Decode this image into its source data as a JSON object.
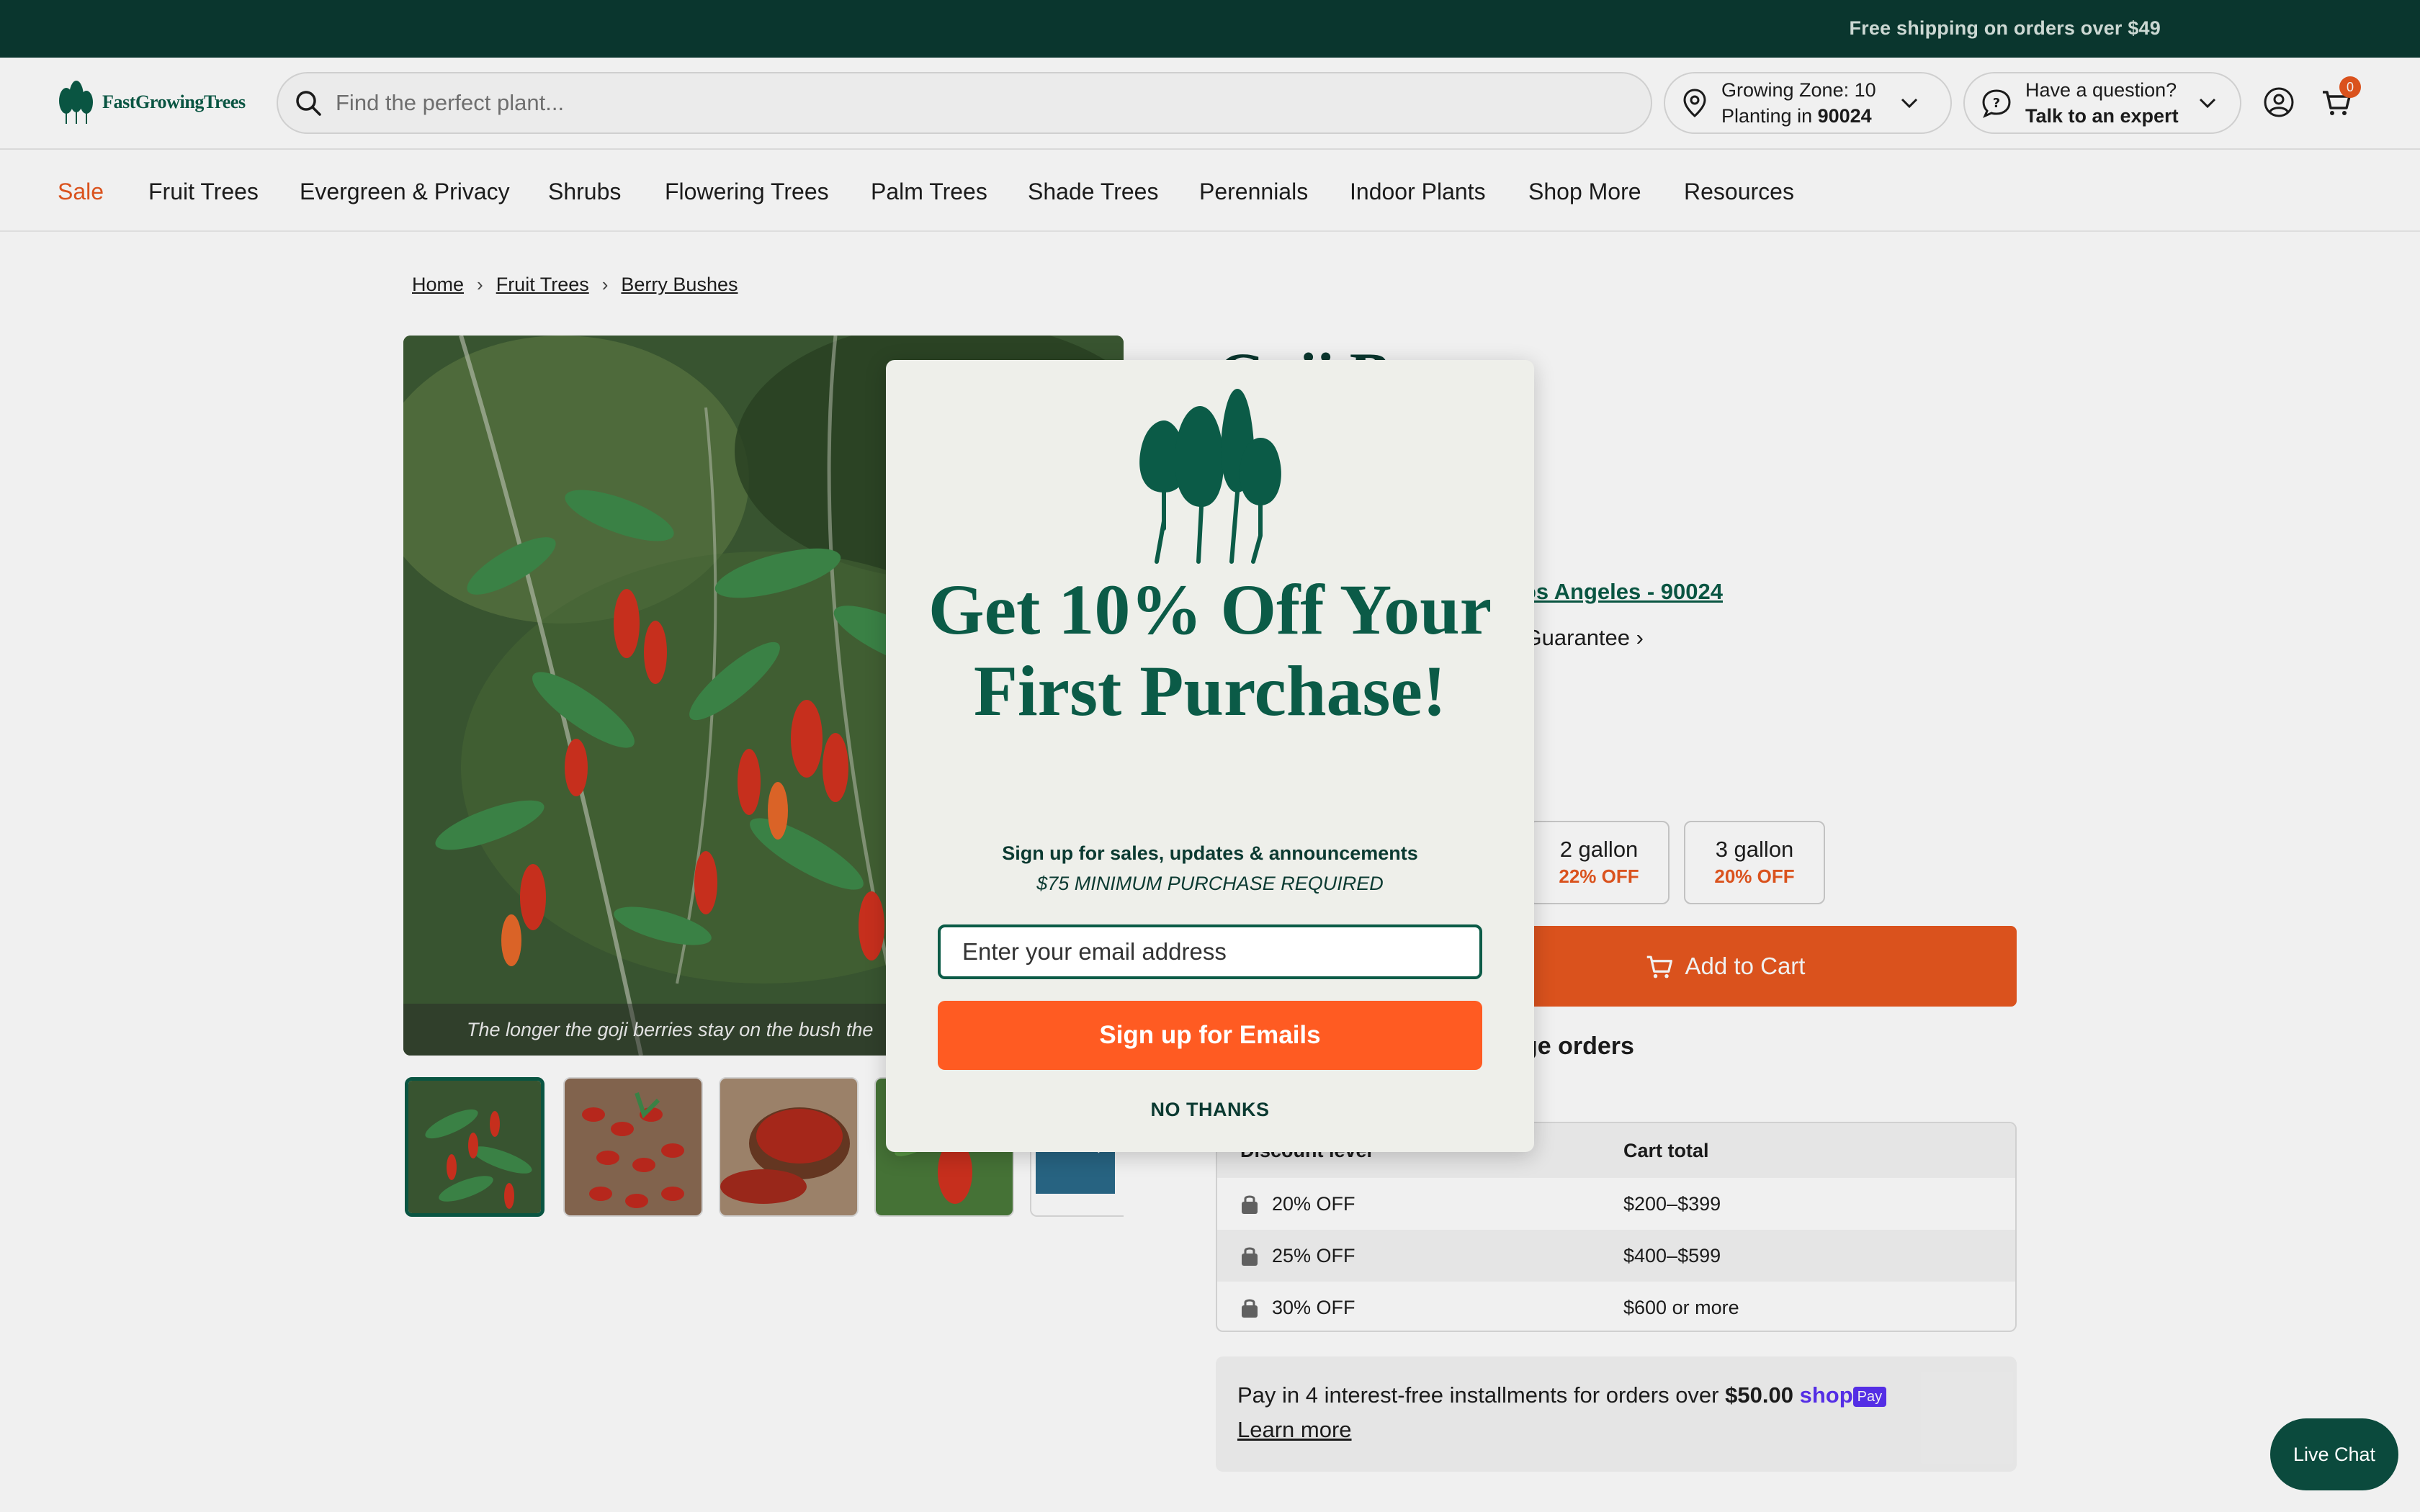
{
  "promo": {
    "text": "Free shipping on orders over $49"
  },
  "header": {
    "logo_text": "FastGrowingTrees",
    "search_placeholder": "Find the perfect plant...",
    "zone_line1": "Growing Zone: 10",
    "zone_line2_prefix": "Planting in ",
    "zone_line2_zip": "90024",
    "question_line1": "Have a question?",
    "question_line2": "Talk to an expert",
    "cart_count": "0"
  },
  "nav": {
    "items": [
      "Sale",
      "Fruit Trees",
      "Evergreen & Privacy",
      "Shrubs",
      "Flowering Trees",
      "Palm Trees",
      "Shade Trees",
      "Perennials",
      "Indoor Plants",
      "Shop More",
      "Resources"
    ]
  },
  "breadcrumb": [
    "Home",
    "Fruit Trees",
    "Berry Bushes"
  ],
  "gallery": {
    "caption": "The longer the goji berries stay on the bush the"
  },
  "product": {
    "title_partial": "Goji B",
    "location_link": "os Angeles - 90024",
    "guarantee": "' Guarantee",
    "sizes": [
      {
        "label": "2 gallon",
        "discount": "22% OFF"
      },
      {
        "label": "3 gallon",
        "discount": "20% OFF"
      }
    ],
    "add_to_cart": "Add to Cart",
    "bulk_heading": "ge orders"
  },
  "discount_table": {
    "headers": [
      "Discount level",
      "Cart total"
    ],
    "rows": [
      {
        "level": "20% OFF",
        "total": "$200–$399"
      },
      {
        "level": "25% OFF",
        "total": "$400–$599"
      },
      {
        "level": "30% OFF",
        "total": "$600 or more"
      }
    ]
  },
  "installments": {
    "text": "Pay in 4 interest-free installments for orders over ",
    "amount": "$50.00",
    "brand": "shop",
    "brand_tag": "Pay",
    "learn_more": "Learn more"
  },
  "modal": {
    "title": "Get 10% Off Your First Purchase!",
    "subtitle": "Sign up for sales, updates & announcements",
    "minimum": "$75 MINIMUM PURCHASE REQUIRED",
    "email_placeholder": "Enter your email address",
    "signup_button": "Sign up for Emails",
    "no_thanks": "NO THANKS"
  },
  "live_chat": "Live Chat",
  "colors": {
    "brand_green": "#0b5b47",
    "dark_green": "#0b3a31",
    "accent_orange": "#e8581f",
    "signup_orange": "#ff5b22"
  }
}
